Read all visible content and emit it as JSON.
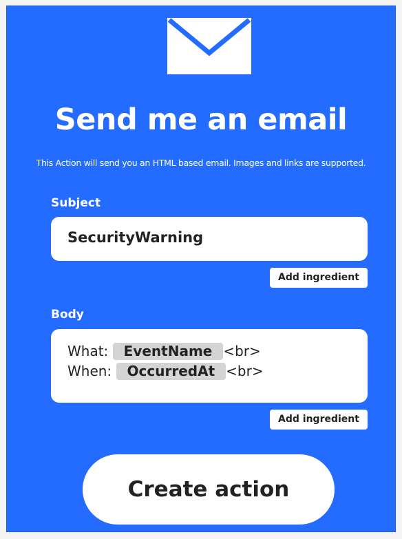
{
  "header": {
    "icon": "envelope-icon",
    "title": "Send me an email",
    "description": "This Action will send you an HTML based email. Images and links are supported."
  },
  "subject": {
    "label": "Subject",
    "value": "SecurityWarning",
    "add_ingredient_label": "Add ingredient"
  },
  "body": {
    "label": "Body",
    "lines": [
      {
        "prefix": "What: ",
        "ingredient": "EventName",
        "suffix": "<br>"
      },
      {
        "prefix": "When: ",
        "ingredient": "OccurredAt",
        "suffix": "<br>"
      }
    ],
    "add_ingredient_label": "Add ingredient"
  },
  "actions": {
    "create_label": "Create action"
  },
  "colors": {
    "background": "#246bff",
    "surface": "#ffffff",
    "text": "#222222",
    "chip": "#d4d4d4"
  }
}
